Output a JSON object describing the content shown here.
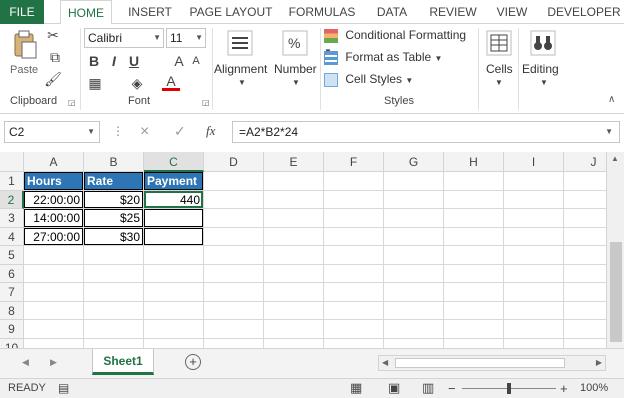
{
  "tabs": [
    "FILE",
    "HOME",
    "INSERT",
    "PAGE LAYOUT",
    "FORMULAS",
    "DATA",
    "REVIEW",
    "VIEW",
    "DEVELOPER"
  ],
  "ribbon": {
    "paste_label": "Paste",
    "clipboard_label": "Clipboard",
    "font_name": "Calibri",
    "font_size": "11",
    "font_label": "Font",
    "bold": "B",
    "italic": "I",
    "underline": "U",
    "alignment_label": "Alignment",
    "number_label": "Number",
    "conditional_formatting": "Conditional Formatting",
    "format_as_table": "Format as Table",
    "cell_styles": "Cell Styles",
    "styles_label": "Styles",
    "cells_label": "Cells",
    "editing_label": "Editing"
  },
  "formula_bar": {
    "name_box": "C2",
    "formula": "=A2*B2*24",
    "fx": "fx",
    "cancel": "×",
    "enter": "✓"
  },
  "grid": {
    "columns": [
      "A",
      "B",
      "C",
      "D",
      "E",
      "F",
      "G",
      "H",
      "I",
      "J"
    ],
    "rows": [
      "1",
      "2",
      "3",
      "4",
      "5",
      "6",
      "7",
      "8",
      "9",
      "10"
    ],
    "cells": {
      "A1": "Hours",
      "B1": "Rate",
      "C1": "Payment",
      "A2": "22:00:00",
      "B2": "$20",
      "C2": "440",
      "A3": "14:00:00",
      "B3": "$25",
      "A4": "27:00:00",
      "B4": "$30"
    }
  },
  "sheet_tab": "Sheet1",
  "status": {
    "mode": "READY",
    "zoom": "100%",
    "zoom_minus": "−",
    "zoom_plus": "+"
  }
}
